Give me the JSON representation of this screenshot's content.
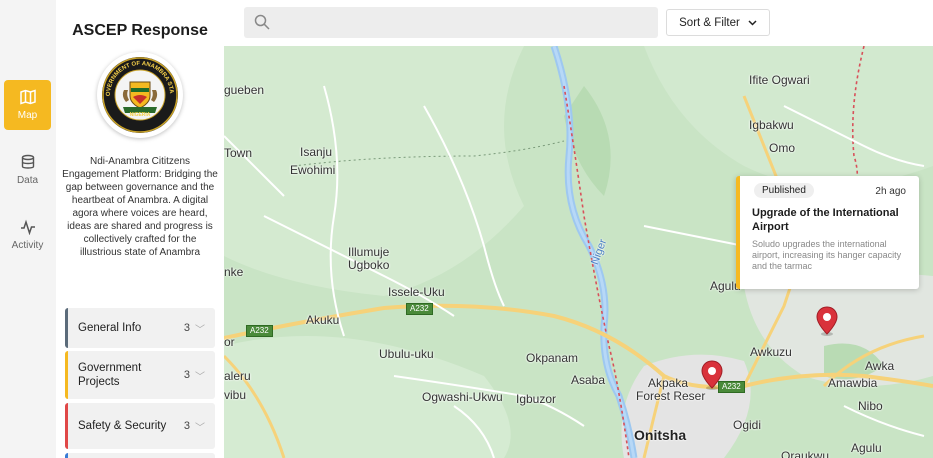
{
  "nav": {
    "items": [
      {
        "label": "Map",
        "icon": "map-icon",
        "active": true
      },
      {
        "label": "Data",
        "icon": "database-icon",
        "active": false
      },
      {
        "label": "Activity",
        "icon": "activity-icon",
        "active": false
      }
    ]
  },
  "sidebar": {
    "title": "ASCEP Response",
    "logo_text": {
      "top": "GOVERNMENT OF ANAMBRA STATE",
      "bottom": "NIGERIA"
    },
    "description": "Ndi-Anambra Cititzens Engagement Platform: Bridging the gap between governance and the heartbeat of Anambra. A digital agora where voices are heard, ideas are shared and progress is collectively crafted for the illustrious state of Anambra",
    "categories": [
      {
        "label": "General Info",
        "count": "3",
        "color": "#5b6b7a"
      },
      {
        "label": "Government Projects",
        "count": "3",
        "color": "#f5b921"
      },
      {
        "label": "Safety & Security",
        "count": "3",
        "color": "#e04848"
      }
    ]
  },
  "topbar": {
    "search_placeholder": "",
    "sort_label": "Sort & Filter"
  },
  "map": {
    "places": [
      {
        "name": "Ifite Ogwari"
      },
      {
        "name": "gueben"
      },
      {
        "name": "Igbakwu"
      },
      {
        "name": "Town"
      },
      {
        "name": "Isanju"
      },
      {
        "name": "Omo"
      },
      {
        "name": "Ewohimi"
      },
      {
        "name": "Illumuje"
      },
      {
        "name": "Ugboko"
      },
      {
        "name": "nke"
      },
      {
        "name": "Issele-Uku"
      },
      {
        "name": "Agulu"
      },
      {
        "name": "Akuku"
      },
      {
        "name": "or"
      },
      {
        "name": "Ubulu-uku"
      },
      {
        "name": "Okpanam"
      },
      {
        "name": "Awkuzu"
      },
      {
        "name": "Awka"
      },
      {
        "name": "aleru"
      },
      {
        "name": "Asaba"
      },
      {
        "name": "Akpaka"
      },
      {
        "name": "Amawbia"
      },
      {
        "name": "vibu"
      },
      {
        "name": "Ogwashi-Ukwu"
      },
      {
        "name": "Igbuzor"
      },
      {
        "name": "Forest Reser"
      },
      {
        "name": "Nibo"
      },
      {
        "name": "Ogidi"
      },
      {
        "name": "Onitsha"
      },
      {
        "name": "Agulu"
      },
      {
        "name": "Oraukwu"
      }
    ],
    "river_label": "Niger",
    "road_tags": [
      "A232",
      "A232",
      "A232"
    ]
  },
  "popup": {
    "status": "Published",
    "time_ago": "2h ago",
    "title": "Upgrade of the International Airport",
    "body": "Soludo upgrades the international airport, increasing its hanger capacity and the tarmac"
  }
}
